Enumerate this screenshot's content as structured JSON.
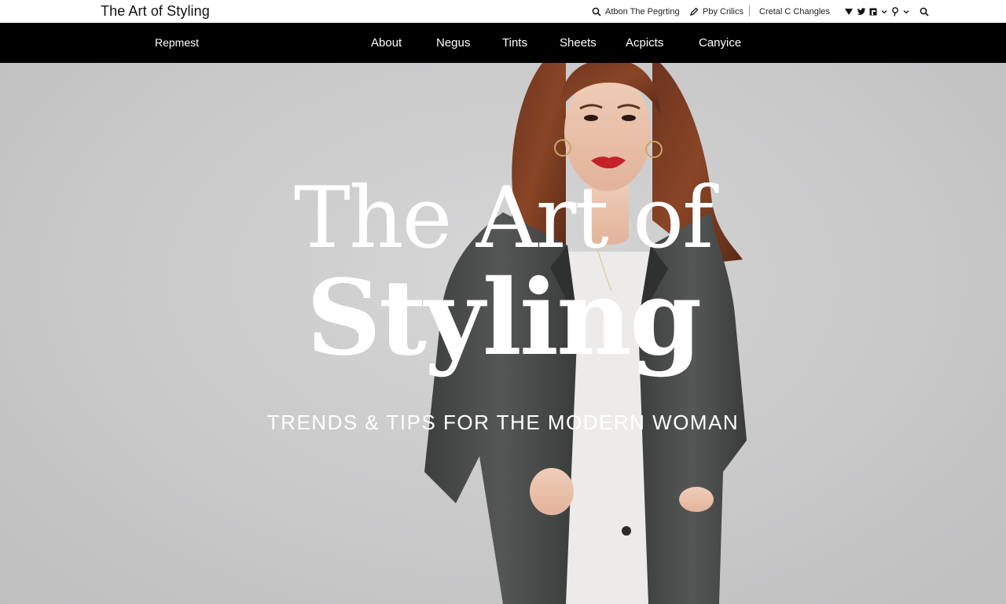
{
  "topbar": {
    "site_title": "The Art of Styling",
    "util_links": [
      {
        "icon": "search-icon",
        "label": "Atbon The Pegrting"
      },
      {
        "icon": "pen-icon",
        "label": "Pby Crilics"
      },
      {
        "label": "Cretal C Changles"
      }
    ],
    "socials": [
      "instagram-icon",
      "twitter-icon",
      "flipboard-icon",
      "pinterest-icon",
      "search-icon"
    ]
  },
  "nav": {
    "brand": "Repmest",
    "items": [
      "About",
      "Negus",
      "Tints",
      "Sheets",
      "Acpicts",
      "Canyice"
    ]
  },
  "hero": {
    "headline_line1": "The Art of",
    "headline_line2": "Styling",
    "tagline": "TRENDS & TIPS FOR THE MODERN WOMAN"
  },
  "colors": {
    "nav_bg": "#000000",
    "hero_bg": "#cbcbcc",
    "text_light": "#ffffff",
    "lipstick": "#c8202b"
  }
}
